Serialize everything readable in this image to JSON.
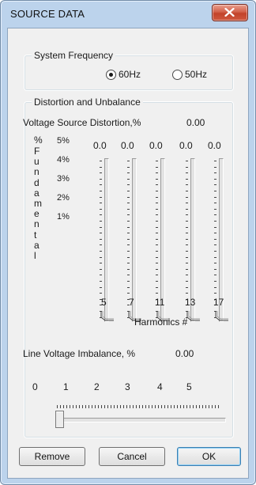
{
  "window": {
    "title": "SOURCE DATA"
  },
  "system_frequency": {
    "title": "System Frequency",
    "options": [
      {
        "label": "60Hz",
        "selected": true
      },
      {
        "label": "50Hz",
        "selected": false
      }
    ]
  },
  "distortion": {
    "title": "Distortion and Unbalance",
    "voltage_source_label": "Voltage Source Distortion,%",
    "voltage_source_value": "0.00",
    "y_axis_label_letters": [
      "%",
      "F",
      "u",
      "n",
      "d",
      "a",
      "m",
      "e",
      "n",
      "t",
      "a",
      "l"
    ],
    "y_ticks": [
      "5%",
      "4%",
      "3%",
      "2%",
      "1%"
    ],
    "harmonics_axis_label": "Harmonics #",
    "harmonics": [
      {
        "number": "5",
        "value": "0.0",
        "level": 0.0
      },
      {
        "number": "7",
        "value": "0.0",
        "level": 0.0
      },
      {
        "number": "11",
        "value": "0.0",
        "level": 0.0
      },
      {
        "number": "13",
        "value": "0.0",
        "level": 0.0
      },
      {
        "number": "17",
        "value": "0.0",
        "level": 0.0
      }
    ],
    "line_imbalance_label": "Line Voltage Imbalance, %",
    "line_imbalance_value": "0.00",
    "imbalance_scale": [
      "0",
      "1",
      "2",
      "3",
      "4",
      "5"
    ],
    "imbalance_level": 0
  },
  "buttons": {
    "remove": "Remove",
    "cancel": "Cancel",
    "ok": "OK"
  },
  "colors": {
    "frame": "#bcd3ec",
    "close": "#c2432a",
    "client": "#f0f0f0"
  }
}
